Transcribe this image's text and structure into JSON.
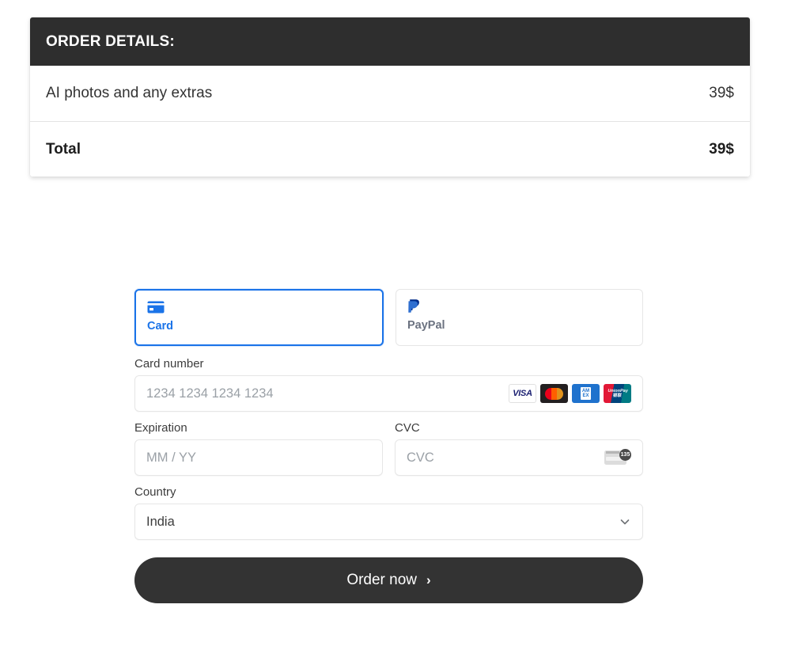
{
  "order_details": {
    "header_title": "ORDER DETAILS:",
    "rows": [
      {
        "label": "AI photos and any extras",
        "value": "39$"
      },
      {
        "label": "Total",
        "value": "39$"
      }
    ]
  },
  "payment": {
    "methods": [
      {
        "label": "Card",
        "icon": "credit-card-icon",
        "selected": true
      },
      {
        "label": "PayPal",
        "icon": "paypal-icon",
        "selected": false
      }
    ],
    "card_number": {
      "label": "Card number",
      "placeholder": "1234 1234 1234 1234",
      "value": "",
      "brands": [
        "VISA",
        "Mastercard",
        "American Express",
        "UnionPay"
      ],
      "visa_text": "VISA",
      "amex_line1": "AM",
      "amex_line2": "EX",
      "unionpay_line1": "UnionPay",
      "unionpay_line2": "银联"
    },
    "expiration": {
      "label": "Expiration",
      "placeholder": "MM / YY",
      "value": ""
    },
    "cvc": {
      "label": "CVC",
      "placeholder": "CVC",
      "value": "",
      "hint_badge": "135"
    },
    "country": {
      "label": "Country",
      "value": "India"
    },
    "submit": {
      "label": "Order now",
      "arrow": "›"
    }
  },
  "colors": {
    "header_bg": "#2e2e2e",
    "accent_blue": "#1a73e8",
    "button_bg": "#333333",
    "placeholder": "#9aa0a6"
  }
}
